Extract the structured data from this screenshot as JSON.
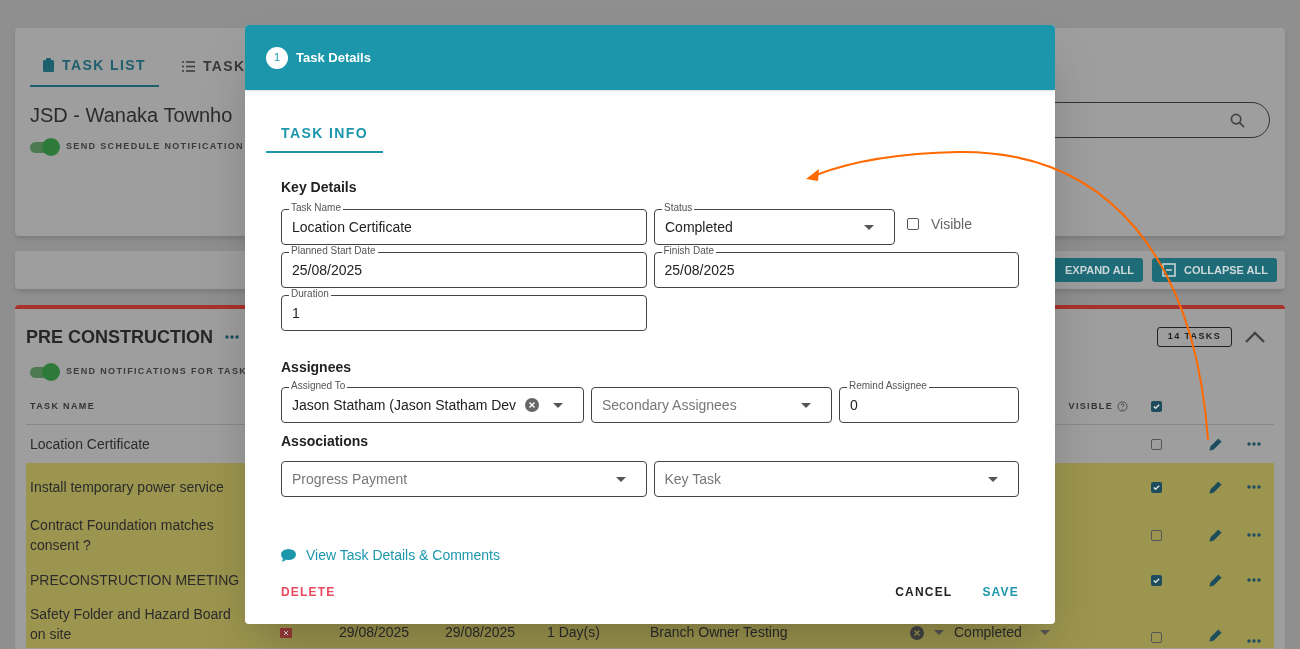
{
  "background": {
    "tabs": [
      {
        "label": "TASK LIST",
        "selected": true
      },
      {
        "label": "TASK",
        "selected": false
      }
    ],
    "project_title": "JSD - Wanaka Townho",
    "schedule_toggle": {
      "label": "SEND SCHEDULE NOTIFICATION",
      "on": true
    },
    "toolbar_buttons": [
      "EXPAND ALL",
      "COLLAPSE ALL"
    ],
    "group": {
      "title": "PRE CONSTRUCTION",
      "toggle": {
        "label": "SEND NOTIFICATIONS FOR TASK",
        "on": true
      },
      "count": "14 TASKS",
      "expanded": true,
      "columns": {
        "task_name": "TASK NAME",
        "visible": "VISIBLE",
        "all_visible": true
      },
      "rows": [
        {
          "name": "Location Certificate",
          "highlighted": false,
          "visible": false
        },
        {
          "name": "Install temporary power service",
          "highlighted": true,
          "visible": true
        },
        {
          "name": "Contract Foundation matches consent ?",
          "highlighted": true,
          "visible": false
        },
        {
          "name": "PRECONSTRUCTION MEETING",
          "highlighted": true,
          "visible": true
        },
        {
          "name": "Safety Folder and Hazard Board on site",
          "highlighted": true,
          "visible": false,
          "start": "29/08/2025",
          "finish": "29/08/2025",
          "duration": "1 Day(s)",
          "assignee": "Branch Owner Testing",
          "status": "Completed"
        }
      ]
    }
  },
  "dialog": {
    "step": "1",
    "title": "Task Details",
    "tabs": [
      {
        "label": "TASK INFO",
        "selected": true
      }
    ],
    "key_details": {
      "heading": "Key Details",
      "task_name": {
        "label": "Task Name",
        "value": "Location Certificate"
      },
      "status": {
        "label": "Status",
        "value": "Completed"
      },
      "visible": {
        "label": "Visible",
        "checked": false
      },
      "planned_start": {
        "label": "Planned Start Date",
        "value": "25/08/2025"
      },
      "finish": {
        "label": "Finish Date",
        "value": "25/08/2025"
      },
      "duration": {
        "label": "Duration",
        "value": "1"
      }
    },
    "assignees": {
      "heading": "Assignees",
      "assigned_to": {
        "label": "Assigned To",
        "value": "Jason Statham (Jason Statham Dev"
      },
      "secondary": {
        "placeholder": "Secondary Assignees"
      },
      "remind": {
        "label": "Remind Assignee",
        "value": "0"
      }
    },
    "associations": {
      "heading": "Associations",
      "progress_payment": {
        "placeholder": "Progress Payment"
      },
      "key_task": {
        "placeholder": "Key Task"
      }
    },
    "link": "View Task Details & Comments",
    "actions": {
      "delete": "DELETE",
      "cancel": "CANCEL",
      "save": "SAVE"
    }
  }
}
